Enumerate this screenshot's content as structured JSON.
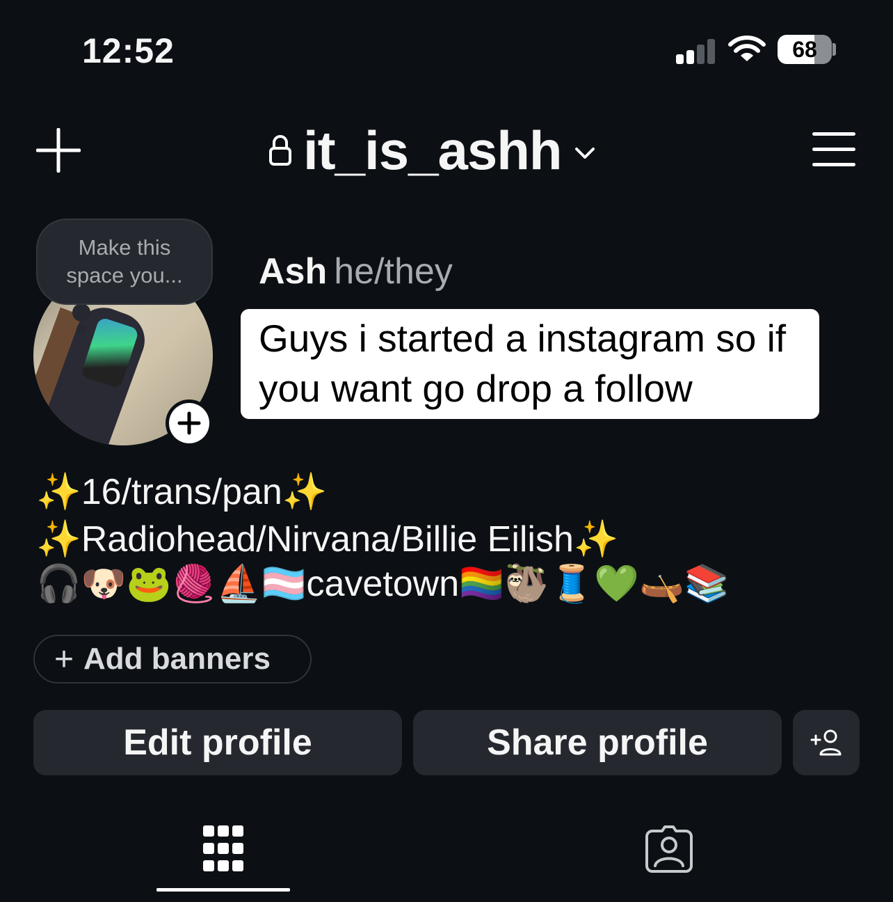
{
  "status_bar": {
    "time": "12:52",
    "battery": "68",
    "battery_level": 0.68
  },
  "header": {
    "username": "it_is_ashh"
  },
  "note": {
    "line1": "Make this",
    "line2": "space you..."
  },
  "profile": {
    "name": "Ash",
    "pronouns": "he/they"
  },
  "caption": {
    "text": "Guys i started a instagram so if you want go drop a follow"
  },
  "bio": {
    "line1": "✨16/trans/pan✨",
    "line2": "✨Radiohead/Nirvana/Billie Eilish✨",
    "line3": "🎧🐶🐸🧶⛵🏳️‍⚧️cavetown🏳️‍🌈🦥🧵💚🛶📚"
  },
  "banners": {
    "label": "Add banners"
  },
  "actions": {
    "edit": "Edit profile",
    "share": "Share profile"
  },
  "icons": [
    "plus-icon",
    "lock-icon",
    "chevron-down-icon",
    "menu-icon",
    "grid-icon",
    "tagged-icon",
    "add-person-icon"
  ],
  "colors": {
    "background": "#0c1014",
    "button": "#25292f",
    "muted_text": "#a8acb1"
  }
}
